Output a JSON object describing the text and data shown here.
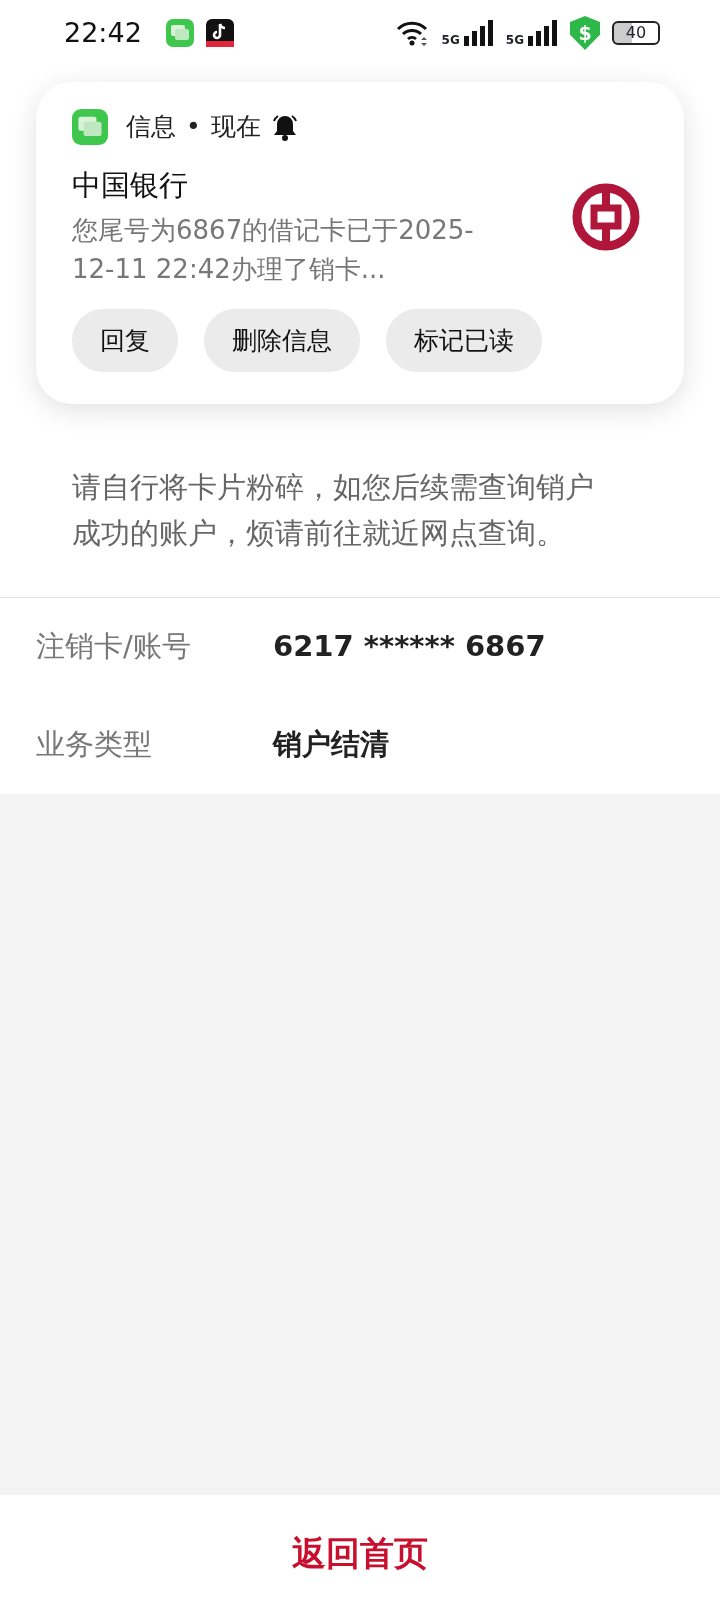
{
  "status_bar": {
    "time": "22:42",
    "network_1": "5G",
    "network_2": "5G",
    "security_glyph": "$",
    "battery": "40"
  },
  "notification": {
    "app": "信息",
    "separator": "•",
    "time": "现在",
    "sender": "中国银行",
    "body": "您尾号为6867的借记卡已于2025-12-11 22:42办理了销卡...",
    "actions": [
      "回复",
      "删除信息",
      "标记已读"
    ]
  },
  "result": {
    "message": "请自行将卡片粉碎，如您后续需查询销户成功的账户，烦请前往就近网点查询。"
  },
  "details": [
    {
      "label": "注销卡/账号",
      "value": "6217 ****** 6867"
    },
    {
      "label": "业务类型",
      "value": "销户结清"
    }
  ],
  "footer_button": "返回首页"
}
